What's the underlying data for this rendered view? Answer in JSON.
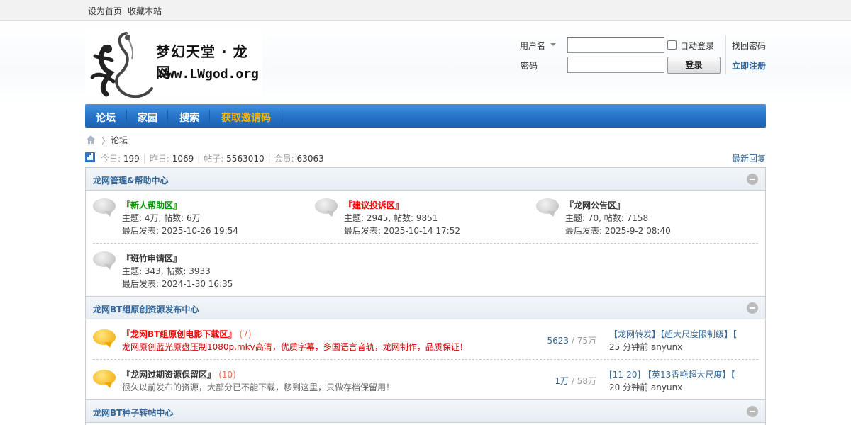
{
  "topbar": {
    "set_home": "设为首页",
    "bookmark": "收藏本站"
  },
  "logo": {
    "brand": "梦幻天堂 · 龙网",
    "url": "www.LWgod.org"
  },
  "login": {
    "username_label": "用户名",
    "password_label": "密码",
    "auto_login": "自动登录",
    "login_button": "登录",
    "find_password": "找回密码",
    "register": "立即注册"
  },
  "nav": {
    "items": [
      {
        "label": "论坛"
      },
      {
        "label": "家园"
      },
      {
        "label": "搜索"
      },
      {
        "label": "获取邀请码"
      }
    ]
  },
  "breadcrumb": {
    "arrow": "〉",
    "current": "论坛"
  },
  "stats": {
    "today_label": "今日:",
    "today": "199",
    "yesterday_label": "昨日:",
    "yesterday": "1069",
    "posts_label": "帖子:",
    "posts": "5563010",
    "members_label": "会员:",
    "members": "63063",
    "sep": "|",
    "latest_reply": "最新回复"
  },
  "categories": [
    {
      "title": "龙网管理&帮助中心",
      "forums": [
        {
          "name": "『新人帮助区』",
          "color": "#009900",
          "topics": "主题: 4万, 帖数: 6万",
          "last": "最后发表: 2025-10-26 19:54"
        },
        {
          "name": "『建议投诉区』",
          "color": "#ff0000",
          "topics": "主题: 2945, 帖数: 9851",
          "last": "最后发表: 2025-10-14 17:52"
        },
        {
          "name": "『龙网公告区』",
          "color": "#333333",
          "topics": "主题: 70, 帖数: 7158",
          "last": "最后发表: 2025-9-2 08:40"
        },
        {
          "name": "『斑竹申请区』",
          "color": "#333333",
          "topics": "主题: 343, 帖数: 3933",
          "last": "最后发表: 2024-1-30 16:35"
        }
      ]
    },
    {
      "title": "龙网BT组原创资源发布中心",
      "forums": [
        {
          "name": "『龙网BT组原创电影下载区』",
          "color": "#ff0000",
          "count": "(7)",
          "desc": "龙网原创蓝光原盘压制1080p.mkv高清，优质字幕，多国语言音轨，龙网制作，品质保证！",
          "threads": "5623",
          "slash": "/",
          "posts": "75万",
          "last_title": "【龙网转发】【超大尺度限制级】【",
          "last_meta": "25 分钟前 anyunx"
        },
        {
          "name": "『龙网过期资源保留区』",
          "color": "#333333",
          "count": "(10)",
          "desc": "很久以前发布的资源，大部分已不能下载，移到这里，只做存档保留用！",
          "threads": "1万",
          "slash": "/",
          "posts": "58万",
          "last_title": "[11-20] 【英13香艳超大尺度】【",
          "last_meta": "20 分钟前 anyunx"
        }
      ]
    },
    {
      "title": "龙网BT种子转帖中心"
    }
  ],
  "colors": {
    "nav_blue": "#2672c6",
    "link_blue": "#336699",
    "nav_highlight": "#ffb400"
  },
  "icons": {
    "home": "home-icon",
    "stats": "bar-chart-icon",
    "forum": "speech-bubble-icon",
    "collapse": "minus-circle-icon",
    "dropdown": "caret-down-icon"
  }
}
